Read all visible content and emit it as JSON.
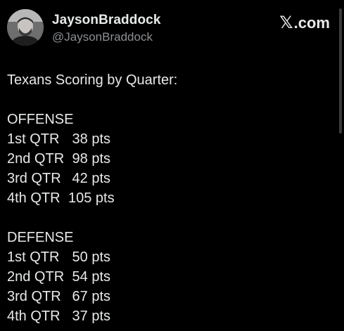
{
  "author": {
    "display_name": "JaysonBraddock",
    "handle": "@JaysonBraddock",
    "avatar_icon": "profile-photo"
  },
  "brand": {
    "x_glyph": "𝕏",
    "text": ".com"
  },
  "post": {
    "title": "Texans Scoring by Quarter:",
    "offense": {
      "label": "OFFENSE",
      "rows": [
        {
          "quarter": "1st QTR",
          "points": " 38 pts"
        },
        {
          "quarter": "2nd QTR",
          "points": " 98 pts"
        },
        {
          "quarter": "3rd QTR",
          "points": " 42 pts"
        },
        {
          "quarter": "4th QTR",
          "points": "105 pts"
        }
      ]
    },
    "defense": {
      "label": "DEFENSE",
      "rows": [
        {
          "quarter": "1st QTR",
          "points": " 50 pts"
        },
        {
          "quarter": "2nd QTR",
          "points": " 54 pts"
        },
        {
          "quarter": "3rd QTR",
          "points": " 67 pts"
        },
        {
          "quarter": "4th QTR",
          "points": " 37 pts"
        }
      ]
    }
  },
  "colors": {
    "background": "#000000",
    "text": "#e7e9ea",
    "secondary_text": "#8b8f94"
  }
}
